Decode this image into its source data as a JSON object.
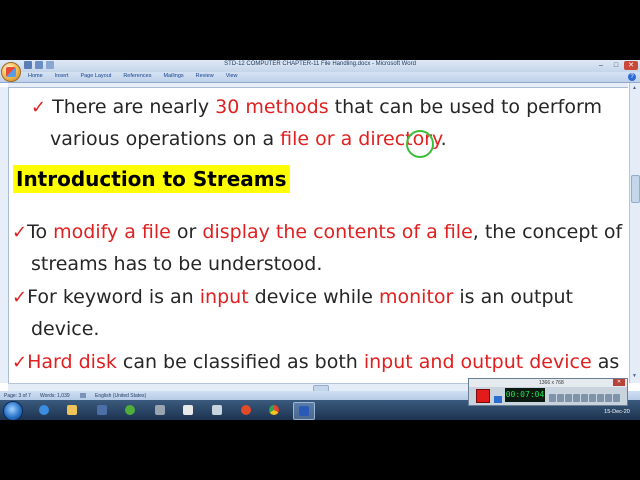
{
  "window": {
    "title": "STD-12 COMPUTER CHAPTER-11 File Handling.docx - Microsoft Word",
    "controls": [
      "–",
      "□",
      "✕"
    ]
  },
  "ribbon": {
    "tabs": [
      "Home",
      "Insert",
      "Page Layout",
      "References",
      "Mailings",
      "Review",
      "View"
    ]
  },
  "document": {
    "intro_line1": {
      "a": "There are nearly ",
      "b": "30 methods",
      "c": " that can be used to perform"
    },
    "intro_line2": {
      "a": "various operations on a ",
      "b": "file or a directory",
      "c": "."
    },
    "heading": "Introduction to Streams",
    "bullet1_line1": {
      "a": "To ",
      "b": "modify a file",
      "c": " or ",
      "d": "display the contents of a file",
      "e": ", the concept of"
    },
    "bullet1_line2": "streams has to be understood.",
    "bullet2_line1": {
      "a": "For keyword is an ",
      "b": "input",
      "c": " device while ",
      "d": "monitor",
      "e": " is an output"
    },
    "bullet2_line2": "device.",
    "bullet3_line1": {
      "a": "Hard disk",
      "b": " can be classified as both ",
      "c": "input and output device",
      "d": " as"
    },
    "checkmark": "✓"
  },
  "statusbar": {
    "page": "Page: 3 of 7",
    "words": "Words: 1,039",
    "language": "English (United States)"
  },
  "recorder": {
    "title": "1366 x 768",
    "timer": "00:07:04"
  },
  "clock": {
    "time": "5:32 PM",
    "date": "15-Dec-20"
  },
  "colors": {
    "accent_red": "#e02020",
    "highlight_yellow": "#ffff00",
    "cursor_green": "#3bbf3b"
  }
}
